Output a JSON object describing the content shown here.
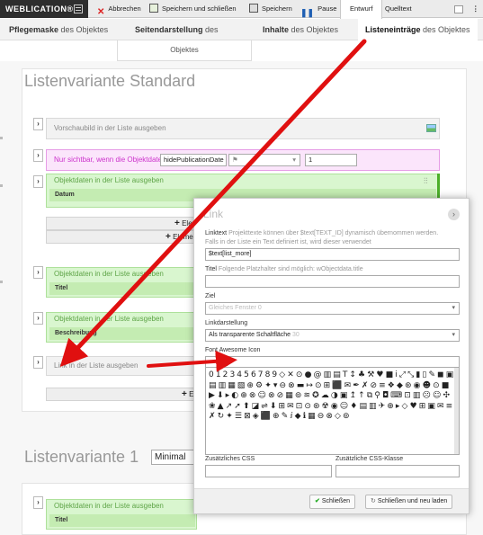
{
  "toolbar": {
    "brand": "WEBLICATION®",
    "cancel": "Abbrechen",
    "save_close": "Speichern und schließen",
    "save": "Speichern",
    "pause": "Pause",
    "draft": "Entwurf",
    "source": "Quelltext"
  },
  "tabs": {
    "t1_bold": "Pflegemaske",
    "t1_rest": " des Objektes",
    "t2_bold": "Seitendarstellung",
    "t2_rest": " des",
    "t2_line2": "Objektes",
    "t3_bold": "Inhalte",
    "t3_rest": " des Objektes",
    "t4_bold": "Listeneinträge",
    "t4_rest": " des Objektes"
  },
  "main": {
    "heading1": "Listenvariante Standard",
    "row_preview": "Vorschaubild in der Liste ausgeben",
    "row_visible": "Nur sichtbar, wenn die Objektdaten",
    "visible_field": "hidePublicationDate",
    "visible_value": "1",
    "row_objdata1": "Objektdaten in der Liste ausgeben",
    "sub_datum": "Datum",
    "add_elem1": "Eler",
    "add_elem2": "Eleme",
    "row_objdata2": "Objektdaten in der Liste ausgeben",
    "sub_titel": "Titel",
    "row_objdata3": "Objektdaten in der Liste ausgeben",
    "sub_beschreibung": "Beschreibung",
    "row_link": "Link in der Liste ausgeben",
    "add_elem3": "E",
    "heading2": "Listenvariante 1",
    "variant_value": "Minimal",
    "row_objdata4": "Objektdaten in der Liste ausgeben",
    "sub_titel2": "Titel"
  },
  "dialog": {
    "title": "Link",
    "linktext_label": "Linktext",
    "linktext_hint": "Projekttexte können über $text[TEXT_ID] dynamisch übernommen werden.",
    "linktext_hint2": "Falls in der Liste ein Text definiert ist, wird dieser verwendet",
    "linktext_value": "$text[list_more]",
    "titel_label": "Titel",
    "titel_hint": "Folgende Platzhalter sind möglich: wObjectdata.title",
    "ziel_label": "Ziel",
    "ziel_value": "Gleiches Fenster 0",
    "darstellung_label": "Linkdarstellung",
    "darstellung_value": "Als transparente Schaltfläche",
    "darstellung_num": "30",
    "fa_label": "Font Awesome Icon",
    "glyphs": "0123456789◇✕⊙●@▥▤T↕♣⚒♥■i⤢⤡▮▯✎◼▣▤▥▦▧⊕⚙✦▾⊖⊗▬↦⊙⊞⬛✉✒✗⊘≡❖◆⊛◉☻⊙■▶⬇▸◐⊕⊗☺⊗⊘▦⊚≋✪☁◑▣↥↑⧉⚲◘⌨⊡▥☹☺✣❀▲↗➚⬆◪⇌⬇⊞✉⊡⊙⊛☢◉☺♦▤▥✈⊕▸◇♥⊞▣✉≡✗↻✦☰⊠◈⬛⊕✎ⅈ◆ℹ▦⊖⊗◇⊚",
    "css_label": "Zusätzliches CSS",
    "cssclass_label": "Zusätzliche CSS-Klasse",
    "btn_close": "Schließen",
    "btn_close_reload": "Schließen und neu laden"
  },
  "colors": {
    "brand_bg": "#2e2e2e",
    "green_row": "#d9f6cf",
    "pink_row": "#fbe5fb",
    "pause_icon": "#1e5fb3",
    "cancel_icon": "#d22",
    "arrow": "#e01010"
  }
}
